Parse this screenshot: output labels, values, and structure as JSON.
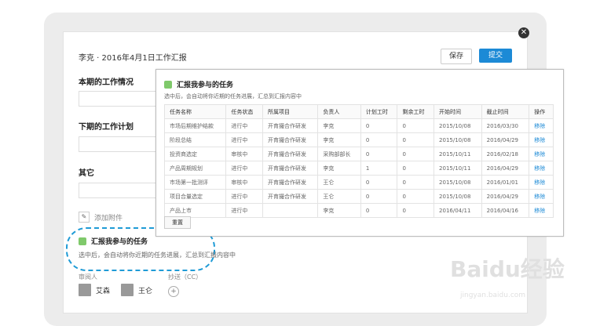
{
  "header": {
    "title": "李克 · 2016年4月1日工作汇报",
    "save_label": "保存",
    "submit_label": "提交"
  },
  "sections": {
    "current": "本期的工作情况",
    "next": "下期的工作计划",
    "other": "其它"
  },
  "attachment": {
    "icon": "paperclip-icon",
    "label": "添加附件"
  },
  "report": {
    "title": "汇报我参与的任务",
    "desc": "选中后，会自动将你近期的任务进展，汇总到汇报内容中"
  },
  "reviewers": {
    "label": "审阅人",
    "people": [
      "艾森",
      "王仑"
    ],
    "cc_label": "抄送（CC）"
  },
  "popup": {
    "title": "汇报我参与的任务",
    "desc": "选中后，会自动将你近期的任务进展，汇总到汇报内容中",
    "columns": [
      "任务名称",
      "任务状态",
      "所属项目",
      "负责人",
      "计划工时",
      "剩余工时",
      "开始时间",
      "截止时间",
      "操作"
    ],
    "rows": [
      [
        "市场后期维护结款",
        "进行中",
        "开育撮合作研发",
        "李克",
        "0",
        "0",
        "2015/10/08",
        "2016/03/30",
        "移除"
      ],
      [
        "阶段总结",
        "进行中",
        "开育撮合作研发",
        "李克",
        "0",
        "0",
        "2015/10/08",
        "2016/04/29",
        "移除"
      ],
      [
        "投资商选定",
        "审核中",
        "开育撮合作研发",
        "采购部部长",
        "0",
        "0",
        "2015/10/11",
        "2016/02/18",
        "移除"
      ],
      [
        "产品周期规划",
        "进行中",
        "开育撮合作研发",
        "李克",
        "1",
        "0",
        "2015/10/11",
        "2016/04/29",
        "移除"
      ],
      [
        "市场第一批测评",
        "审核中",
        "开育撮合作研发",
        "王仑",
        "0",
        "0",
        "2015/10/08",
        "2016/01/01",
        "移除"
      ],
      [
        "项目合量选定",
        "进行中",
        "开育撮合作研发",
        "王仑",
        "0",
        "0",
        "2015/10/08",
        "2016/04/29",
        "移除"
      ],
      [
        "产品上市",
        "进行中",
        "",
        "李克",
        "0",
        "0",
        "2016/04/11",
        "2016/04/16",
        "移除"
      ]
    ],
    "reset_label": "重置"
  },
  "watermark": {
    "main": "Baidu经验",
    "sub": "jingyan.baidu.com"
  }
}
